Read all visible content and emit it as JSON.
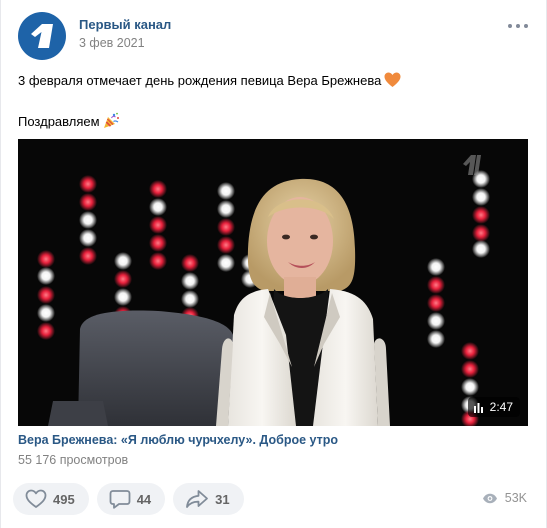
{
  "post": {
    "author": "Первый канал",
    "date": "3 фев 2021",
    "text_line1": "3 февраля отмечает день рождения певица Вера Брежнева",
    "text_line2": "Поздравляем"
  },
  "video": {
    "duration": "2:47",
    "title": "Вера Брежнева: «Я люблю чурчхелу». Доброе утро",
    "views": "55 176 просмотров"
  },
  "actions": {
    "likes": "495",
    "comments": "44",
    "shares": "31",
    "views": "53K"
  },
  "icons": {
    "avatar": "channel-one-logo",
    "more": "more-horizontal-icon",
    "like": "heart-icon",
    "comment": "comment-icon",
    "share": "share-icon",
    "views": "eye-icon"
  },
  "colors": {
    "link": "#2a5885",
    "muted": "#828282",
    "action_bg": "#f0f2f5",
    "avatar_bg": "#1e63a8"
  }
}
